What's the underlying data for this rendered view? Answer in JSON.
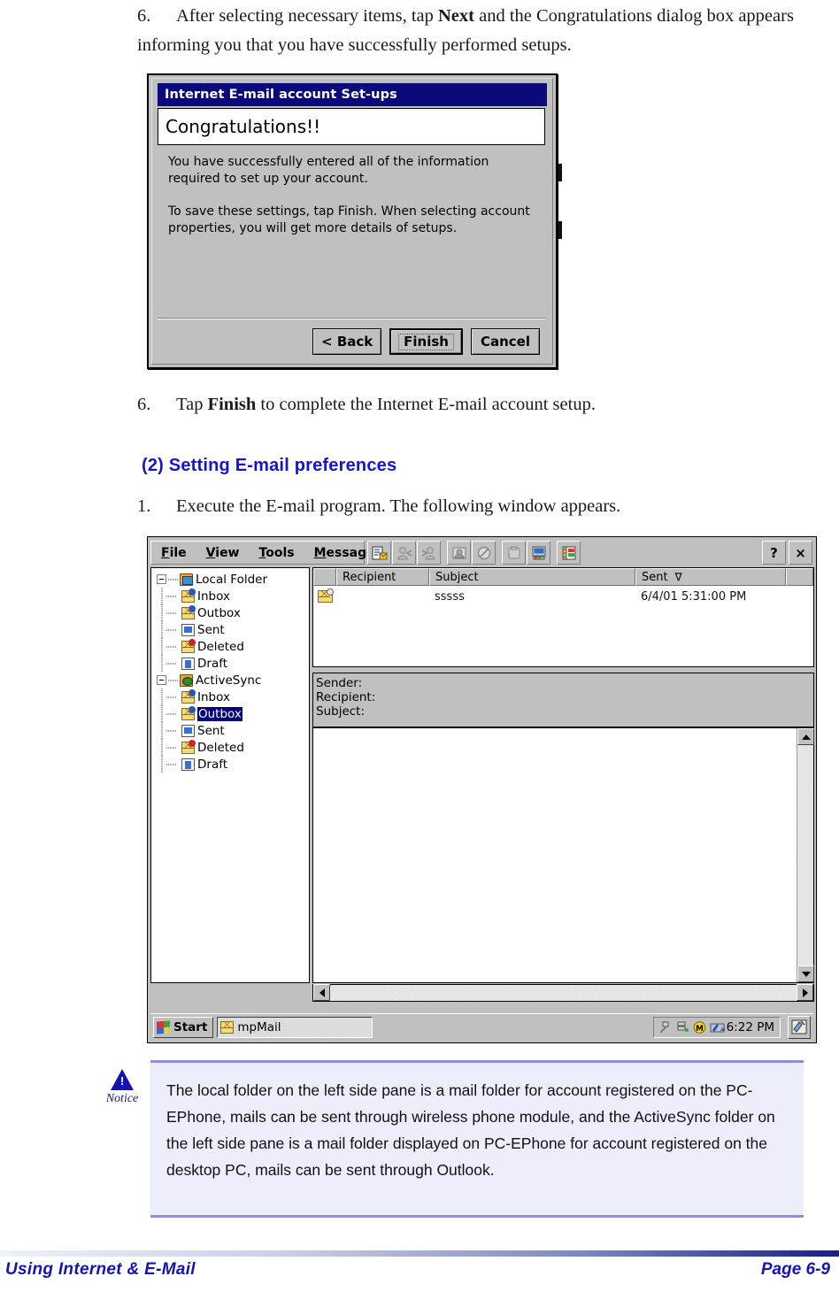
{
  "paragraphs": {
    "step6a_num": "6.",
    "step6a_text_part1": "After selecting necessary items, tap ",
    "step6a_bold": "Next",
    "step6a_text_part2": " and the Congratulations dialog box appears informing you that you have successfully performed setups.",
    "step6b_num": "6.",
    "step6b_text_part1": "Tap ",
    "step6b_bold": "Finish",
    "step6b_text_part2": " to complete the Internet E-mail account setup.",
    "step1_num": "1.",
    "step1_text": "Execute the E-mail program. The following window appears."
  },
  "section_heading": "(2)   Setting E-mail preferences",
  "dialog": {
    "title": "Internet E-mail account Set-ups",
    "heading": "Congratulations!!",
    "body_p1": "You have successfully entered all of the information required to set up your account.",
    "body_p2": "To save these settings, tap Finish. When selecting account properties, you will get more details of setups.",
    "buttons": {
      "back": "< Back",
      "finish": "Finish",
      "cancel": "Cancel"
    }
  },
  "email_window": {
    "menus": [
      {
        "accel": "F",
        "rest": "ile"
      },
      {
        "accel": "V",
        "rest": "iew"
      },
      {
        "accel": "T",
        "rest": "ools"
      },
      {
        "accel": "M",
        "rest": "essage"
      }
    ],
    "toolbar_icons": [
      "new-message-icon",
      "reply-icon",
      "reply-all-icon",
      "forward-icon",
      "delete-icon",
      "copy-icon",
      "send-receive-icon",
      "address-book-icon"
    ],
    "window_buttons": {
      "help": "?",
      "close": "×"
    },
    "tree": [
      {
        "label": "Local Folder",
        "level": 0,
        "icon": "folder-icon",
        "selected": false
      },
      {
        "label": "Inbox",
        "level": 1,
        "icon": "inbox-envelope-icon",
        "selected": false
      },
      {
        "label": "Outbox",
        "level": 1,
        "icon": "outbox-envelope-icon",
        "selected": false
      },
      {
        "label": "Sent",
        "level": 1,
        "icon": "sent-page-icon",
        "selected": false
      },
      {
        "label": "Deleted",
        "level": 1,
        "icon": "deleted-envelope-icon",
        "selected": false
      },
      {
        "label": "Draft",
        "level": 1,
        "icon": "draft-doc-icon",
        "selected": false
      },
      {
        "label": "ActiveSync",
        "level": 0,
        "icon": "activesync-folder-icon",
        "selected": false
      },
      {
        "label": "Inbox",
        "level": 1,
        "icon": "inbox-envelope-icon",
        "selected": false
      },
      {
        "label": "Outbox",
        "level": 1,
        "icon": "outbox-envelope-icon",
        "selected": true
      },
      {
        "label": "Sent",
        "level": 1,
        "icon": "sent-page-icon",
        "selected": false
      },
      {
        "label": "Deleted",
        "level": 1,
        "icon": "deleted-envelope-icon",
        "selected": false
      },
      {
        "label": "Draft",
        "level": 1,
        "icon": "draft-doc-icon",
        "selected": false
      }
    ],
    "list_columns": [
      "",
      "Recipient",
      "Subject",
      "Sent",
      ""
    ],
    "sort_indicator": "∇",
    "list_rows": [
      {
        "icon": "unsent-mail-icon",
        "recipient": "",
        "subject": "sssss",
        "sent": "6/4/01 5:31:00 PM"
      }
    ],
    "detail": {
      "sender_label": "Sender:",
      "recipient_label": "Recipient:",
      "subject_label": "Subject:",
      "body": ""
    },
    "taskbar": {
      "start_label": "Start",
      "task_label": "mpMail",
      "tray_icons": [
        "connection-icon",
        "network-icon",
        "msn-icon",
        "input-panel-icon"
      ],
      "clock": "6:22 PM",
      "desktop_button": "notes-icon"
    }
  },
  "notice": {
    "caption": "Notice",
    "text": "The local folder on the left side pane is a mail folder for account registered on the PC-EPhone, mails can be sent through wireless phone module, and the ActiveSync folder on the left side pane is a mail folder displayed on PC-EPhone for account registered on the desktop PC, mails can be sent through Outlook."
  },
  "footer": {
    "left": "Using Internet & E-Mail",
    "right": "Page 6-9"
  }
}
